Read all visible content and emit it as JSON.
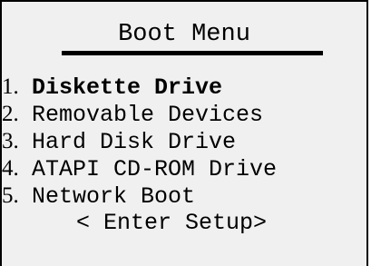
{
  "title": "Boot Menu",
  "items": [
    {
      "number": "1.",
      "label": "Diskette Drive",
      "selected": true
    },
    {
      "number": "2.",
      "label": "Removable Devices",
      "selected": false
    },
    {
      "number": "3.",
      "label": "Hard Disk Drive",
      "selected": false
    },
    {
      "number": "4.",
      "label": "ATAPI CD-ROM Drive",
      "selected": false
    },
    {
      "number": "5.",
      "label": "Network Boot",
      "selected": false
    }
  ],
  "setup_label": "< Enter Setup>",
  "colors": {
    "background": "#f0f0f0",
    "text": "#000000",
    "border": "#000000"
  }
}
